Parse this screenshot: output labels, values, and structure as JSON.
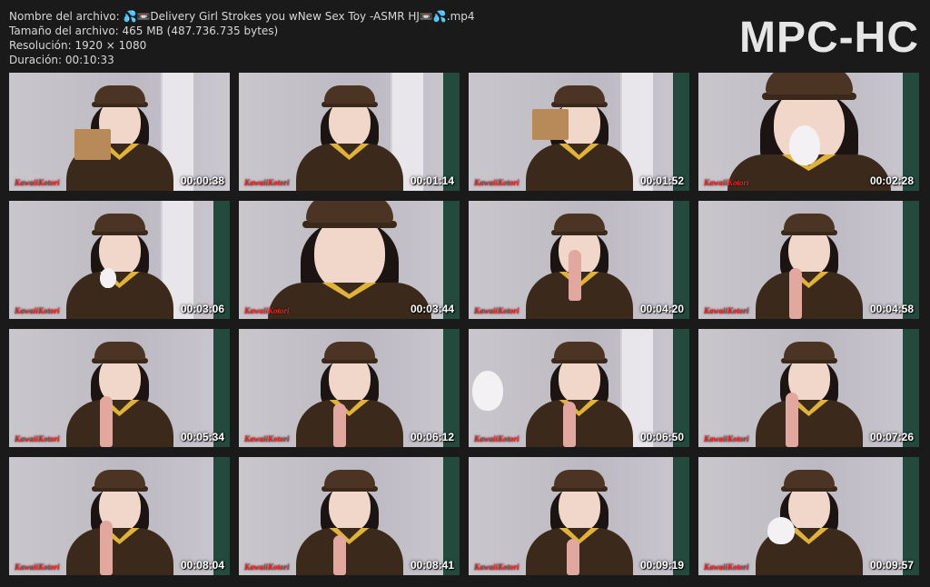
{
  "info": {
    "filename": "Nombre del archivo: 💦📼Delivery Girl Strokes you wNew Sex Toy -ASMR HJ📼💦.mp4",
    "size": "Tamaño del archivo: 465 MB (487.736.735 bytes)",
    "resolution": "Resolución: 1920 × 1080",
    "duration": "Duración: 00:10:33"
  },
  "brand": "MPC-HC",
  "thumbnails": [
    {
      "time": "00:00:38",
      "logo": "KawaiiKotori"
    },
    {
      "time": "00:01:14",
      "logo": "KawaiiKotori"
    },
    {
      "time": "00:01:52",
      "logo": "KawaiiKotori"
    },
    {
      "time": "00:02:28",
      "logo": "KawaiiKotori"
    },
    {
      "time": "00:03:06",
      "logo": "KawaiiKotori"
    },
    {
      "time": "00:03:44",
      "logo": "KawaiiKotori"
    },
    {
      "time": "00:04:20",
      "logo": "KawaiiKotori"
    },
    {
      "time": "00:04:58",
      "logo": "KawaiiKotori"
    },
    {
      "time": "00:05:34",
      "logo": "KawaiiKotori"
    },
    {
      "time": "00:06:12",
      "logo": "KawaiiKotori"
    },
    {
      "time": "00:06:50",
      "logo": "KawaiiKotori"
    },
    {
      "time": "00:07:26",
      "logo": "KawaiiKotori"
    },
    {
      "time": "00:08:04",
      "logo": "KawaiiKotori"
    },
    {
      "time": "00:08:41",
      "logo": "KawaiiKotori"
    },
    {
      "time": "00:09:19",
      "logo": "KawaiiKotori"
    },
    {
      "time": "00:09:57",
      "logo": "KawaiiKotori"
    }
  ]
}
